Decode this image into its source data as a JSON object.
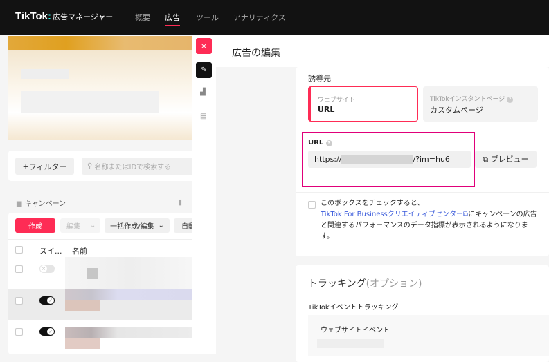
{
  "header": {
    "logo": "TikTok",
    "logo_sub": "広告マネージャー",
    "nav": [
      "概要",
      "広告",
      "ツール",
      "アナリティクス"
    ],
    "active_nav": "広告"
  },
  "left": {
    "filter_button": "+フィルター",
    "search_placeholder": "名称またはIDで検索する",
    "campaign_label": "キャンペーン",
    "create_button": "作成",
    "edit_button": "編集",
    "bulk_button": "一括作成/編集",
    "auto_button": "自動",
    "col_switch": "スイ...",
    "col_name": "名前",
    "rows": [
      {
        "on": false
      },
      {
        "on": true
      },
      {
        "on": true
      }
    ]
  },
  "drawer": {
    "close_icon": "close-icon",
    "title": "広告の編集",
    "destination": {
      "label": "誘導先",
      "options": [
        {
          "sub": "ウェブサイト",
          "main": "URL",
          "selected": true
        },
        {
          "sub": "TikTokインスタントページ",
          "main": "カスタムページ",
          "selected": false
        }
      ]
    },
    "url": {
      "label": "URL",
      "value_prefix": "https://",
      "value_suffix": "/?im=hu6",
      "preview_button": "プレビュー"
    },
    "checkbox_text_1": "このボックスをチェックすると、",
    "checkbox_link": "TikTok For Businessクリエイティブセンター",
    "checkbox_text_2": "にキャンペーンの広告と関連するパフォーマンスのデータ指標が表示されるようになります。",
    "tracking": {
      "title": "トラッキング",
      "title_optional": "(オプション)",
      "event_label": "TikTokイベントトラッキング",
      "website_event": "ウェブサイトイベント"
    }
  },
  "colors": {
    "accent": "#fe2c55",
    "highlight": "#e0007a",
    "link": "#3b5bdb"
  }
}
